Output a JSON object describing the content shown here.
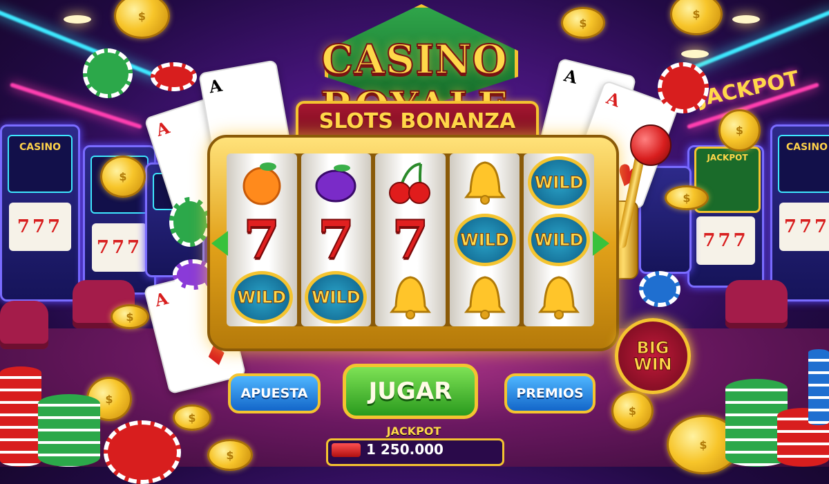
{
  "title": "CASINO ROYALE",
  "subtitle": "SLOTS BONANZA",
  "reels": [
    [
      "orange",
      "7",
      "WILD"
    ],
    [
      "plum",
      "7",
      "WILD"
    ],
    [
      "cherry",
      "7",
      "bell"
    ],
    [
      "bell",
      "WILD",
      "bell"
    ],
    [
      "WILD",
      "WILD",
      "bell"
    ]
  ],
  "seven_symbol": "7",
  "wild_label": "WILD",
  "buttons": {
    "bet": "APUESTA",
    "play": "JUGAR",
    "prizes": "PREMIOS"
  },
  "badge": {
    "line1": "BIG",
    "line2": "WIN"
  },
  "jackpot": {
    "label": "JACKPOT",
    "value": "1 250.000"
  },
  "background": {
    "left_machine_label": "CASINO",
    "right_machine_label": "CASINO",
    "right_sign": "JACKPOT",
    "right_box_label": "JACKPOT",
    "machine_reel_text": "777"
  },
  "colors": {
    "gold": "#f4c430",
    "green_button": "#2a9a1e",
    "blue_button": "#1366c9",
    "accent_red": "#d81e1e",
    "background_purple": "#4a1680"
  }
}
